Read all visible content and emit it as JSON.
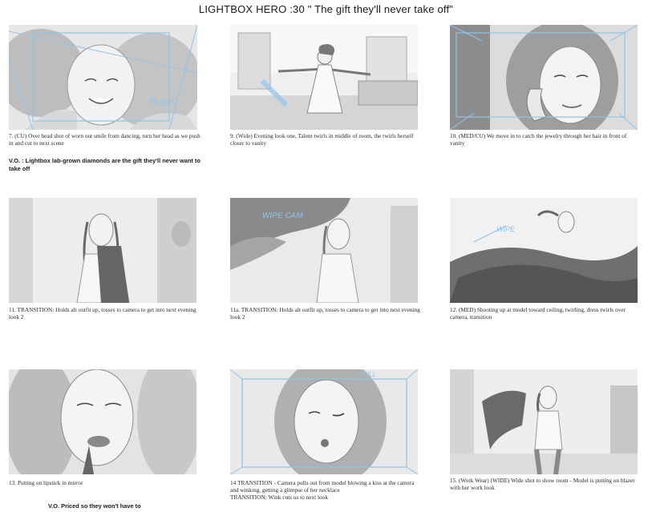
{
  "title": "LIGHTBOX HERO :30 \" The gift they'll never take off\"",
  "panels": [
    {
      "caption": "7.  (CU) Over head shot of worn out smile from dancing, turn her head as we push in and cut to next scene",
      "annotation": "PUSH"
    },
    {
      "caption": "9.  (Wide) Evening look one, Talent twirls in middle of room, the twirls herself closer to vanity"
    },
    {
      "caption": "10. (MED/CU) We move in to catch the jewelry through her hair in front of vanity"
    },
    {
      "caption": "11. TRANSITION: Holds alt outfit up, tosses to camera to get into next evening look 2"
    },
    {
      "caption": "11a. TRANSITION: Holds alt outfit up, tosses to camera to get into next evening look 2",
      "annotation": "WIPE CAM"
    },
    {
      "caption": "12. (MED)  Shooting up at model toward ceiling, twirling, dress twirls over camera, transition",
      "annotation": "WIPE"
    },
    {
      "caption": "13. Putting on lipstick in mirror"
    },
    {
      "caption": "14 TRANSITION - Camera pulls out from model blowing a kiss at the camera and winking, getting a glimpse of her necklace\nTRANSITION: Wink cuts us to next look",
      "annotation": "PULL"
    },
    {
      "caption": "15. (Work Wear) (WIDE) Wide shot to show room - Model is putting on blazer with her work look"
    }
  ],
  "voiceovers": [
    "V.O. : Lightbox lab-grown diamonds are the gift they'll never want to take off",
    "V.O. Priced so they won't have to"
  ],
  "colors": {
    "sketch_blue": "#8fc4ec",
    "sketch_gray": "#9a9a9a",
    "paper": "#ffffff"
  }
}
